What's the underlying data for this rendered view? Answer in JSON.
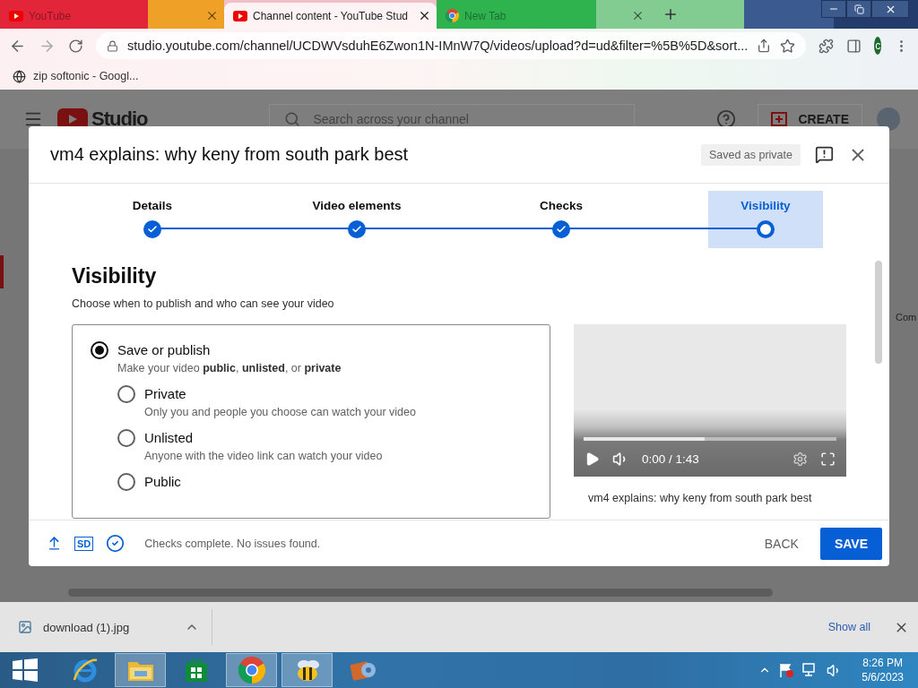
{
  "browser": {
    "tabs": [
      {
        "kind": "youtube",
        "title": "YouTube",
        "selected": false
      },
      {
        "kind": "youtube",
        "title": "Channel content - YouTube Stud",
        "selected": true
      },
      {
        "kind": "chrome",
        "title": "New Tab",
        "selected": false
      }
    ],
    "address": "studio.youtube.com/channel/UCDWVsduhE6Zwon1N-IMnW7Q/videos/upload?d=ud&filter=%5B%5D&sort...",
    "profile": "c",
    "bookmarks": [
      {
        "title": "zip softonic - Googl..."
      }
    ]
  },
  "studio": {
    "logo": "Studio",
    "search_placeholder": "Search across your channel",
    "create": "CREATE",
    "column_text": "Com"
  },
  "dialog": {
    "title": "vm4 explains: why keny from south park best",
    "save_status": "Saved as private",
    "steps": [
      {
        "label": "Details",
        "selected": false,
        "done": true
      },
      {
        "label": "Video elements",
        "selected": false,
        "done": true
      },
      {
        "label": "Checks",
        "selected": false,
        "done": true
      },
      {
        "label": "Visibility",
        "selected": true,
        "done": false
      }
    ],
    "heading": "Visibility",
    "subtitle": "Choose when to publish and who can see your video",
    "options": [
      {
        "label": "Save or publish",
        "description": "Make your video **public**, **unlisted**, or **private**",
        "selected": true,
        "children": [
          {
            "label": "Private",
            "description": "Only you and people you choose can watch your video",
            "selected": false
          },
          {
            "label": "Unlisted",
            "description": "Anyone with the video link can watch your video",
            "selected": false
          },
          {
            "label": "Public",
            "selected": false
          }
        ]
      }
    ],
    "preview": {
      "time": "0:00 / 1:43",
      "level": 0.48,
      "title": "vm4 explains: why keny from south park best"
    },
    "footer": {
      "quality": "SD",
      "status": "Checks complete. No issues found.",
      "back": "BACK",
      "save": "SAVE"
    }
  },
  "downloads": {
    "items": [
      {
        "name": "download (1).jpg"
      }
    ],
    "show_all": "Show all"
  },
  "taskbar": {
    "apps": [
      {
        "kind": "ie",
        "active": false
      },
      {
        "kind": "explorer",
        "active": true
      },
      {
        "kind": "store",
        "active": false
      },
      {
        "kind": "chrome",
        "active": true
      },
      {
        "kind": "bee",
        "active": true
      },
      {
        "kind": "video",
        "active": false
      }
    ],
    "time": "8:26 PM",
    "date": "5/6/2023"
  }
}
